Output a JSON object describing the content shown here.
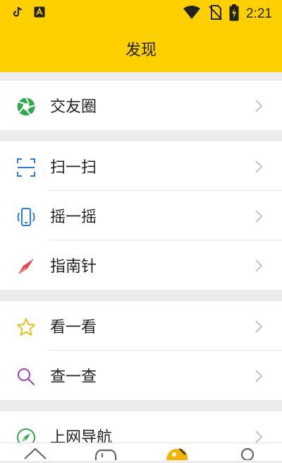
{
  "status_bar": {
    "time": "2:21",
    "icons": [
      "tiktok-icon",
      "text-a-icon",
      "wifi-icon",
      "no-sim-icon",
      "battery-charging-icon"
    ]
  },
  "header": {
    "title": "发现"
  },
  "sections": [
    {
      "items": [
        {
          "label": "交友圈",
          "icon": "moments-aperture-icon",
          "icon_color": "#2FA84F"
        }
      ]
    },
    {
      "items": [
        {
          "label": "扫一扫",
          "icon": "scan-icon",
          "icon_color": "#2C7BE5"
        },
        {
          "label": "摇一摇",
          "icon": "shake-phone-icon",
          "icon_color": "#2C7BE5"
        },
        {
          "label": "指南针",
          "icon": "compass-icon",
          "icon_color": "#E8434A"
        }
      ]
    },
    {
      "items": [
        {
          "label": "看一看",
          "icon": "star-icon",
          "icon_color": "#E8C21A"
        },
        {
          "label": "查一查",
          "icon": "search-icon",
          "icon_color": "#9B3FC2"
        }
      ]
    },
    {
      "items": [
        {
          "label": "上网导航",
          "icon": "navigation-icon",
          "icon_color": "#2FA84F"
        }
      ]
    }
  ],
  "bottom_nav": {
    "tabs": [
      {
        "icon": "home-icon"
      },
      {
        "icon": "game-controller-icon"
      },
      {
        "icon": "discover-palette-icon",
        "active": true
      },
      {
        "icon": "profile-icon"
      }
    ],
    "active_color": "#F4B400"
  },
  "colors": {
    "accent": "#FFD000",
    "background": "#ececec",
    "chevron": "#b8b8b8"
  }
}
